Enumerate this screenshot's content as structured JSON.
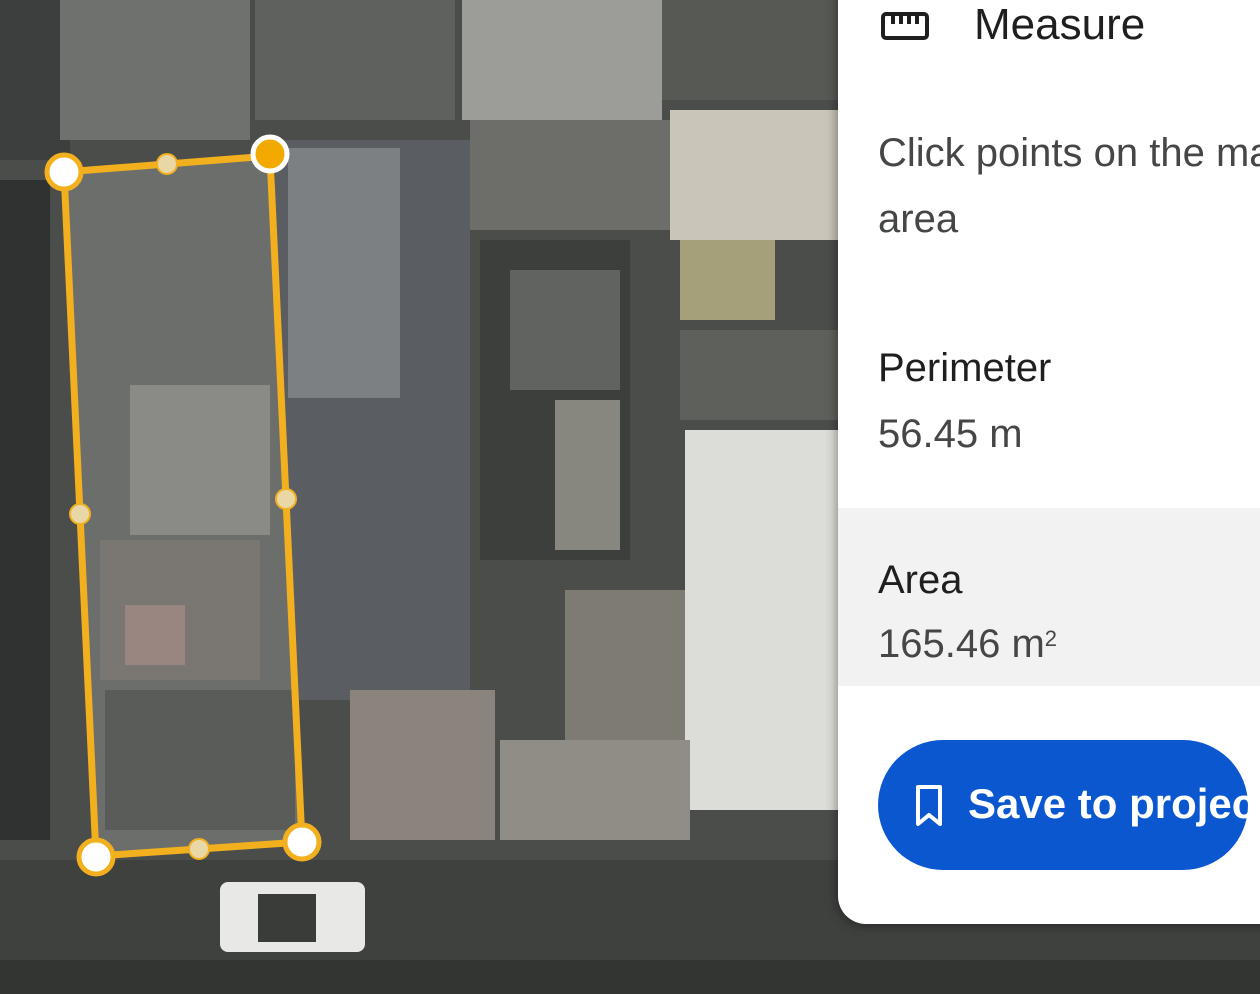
{
  "panel": {
    "title": "Measure",
    "title_icon": "ruler-icon",
    "instructions_line1": "Click points on the map t",
    "instructions_line2": "area",
    "perimeter": {
      "label": "Perimeter",
      "value": "56.45 m"
    },
    "area": {
      "label": "Area",
      "value": "165.46 m",
      "unit_superscript": "2"
    },
    "save_button": {
      "label": "Save to project",
      "icon": "bookmark-icon"
    }
  },
  "colors": {
    "accent_polygon": "#f2b01e",
    "active_vertex": "#f2a900",
    "button_blue": "#0b57d0",
    "panel_bg": "#ffffff",
    "area_section_bg": "#f2f2f2"
  }
}
